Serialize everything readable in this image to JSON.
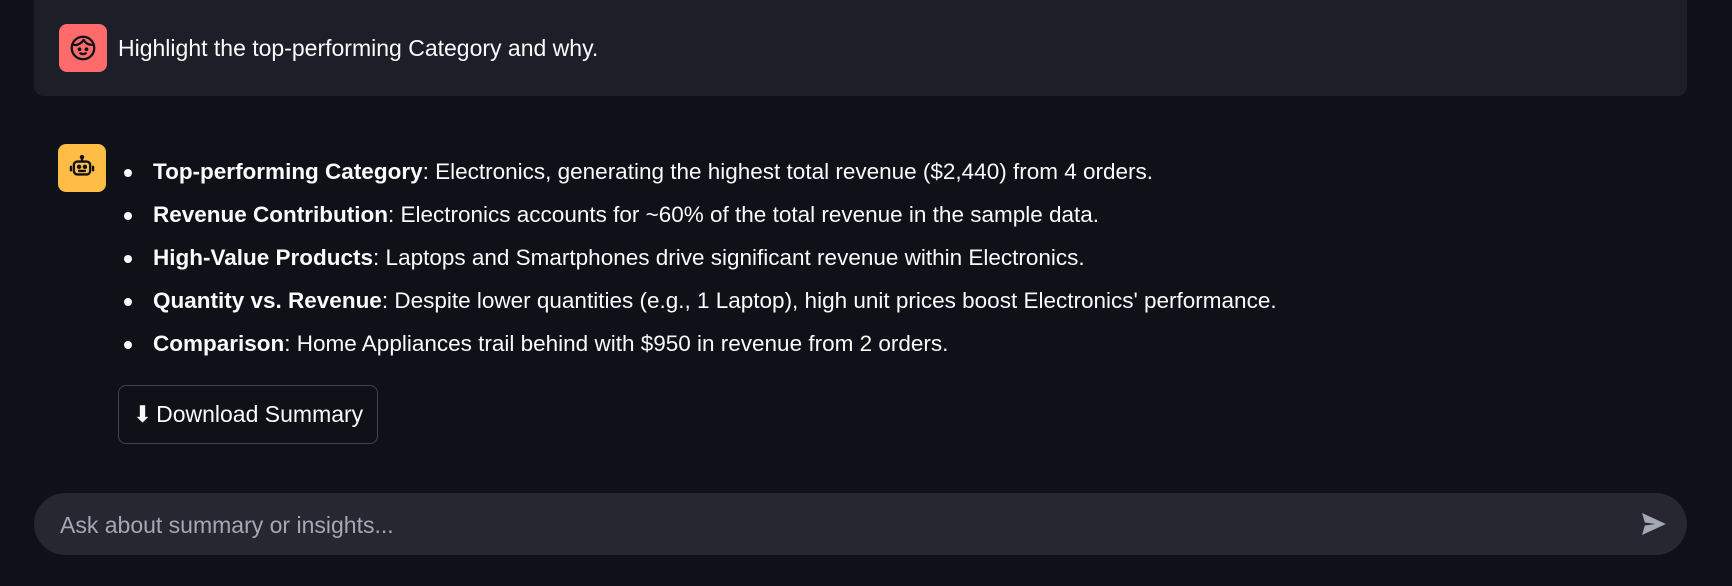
{
  "user_message": {
    "avatar_icon": "user-face-icon",
    "avatar_color": "#ff6b6b",
    "text": "Highlight the top-performing Category and why."
  },
  "assistant_message": {
    "avatar_icon": "robot-icon",
    "avatar_color": "#ffbd45",
    "bullets": [
      {
        "label": "Top-performing Category",
        "text": ": Electronics, generating the highest total revenue ($2,440) from 4 orders."
      },
      {
        "label": "Revenue Contribution",
        "text": ": Electronics accounts for ~60% of the total revenue in the sample data."
      },
      {
        "label": "High-Value Products",
        "text": ": Laptops and Smartphones drive significant revenue within Electronics."
      },
      {
        "label": "Quantity vs. Revenue",
        "text": ": Despite lower quantities (e.g., 1 Laptop), high unit prices boost Electronics' performance."
      },
      {
        "label": "Comparison",
        "text": ": Home Appliances trail behind with $950 in revenue from 2 orders."
      }
    ],
    "download_button": {
      "icon": "⬇",
      "label": "Download Summary"
    }
  },
  "chat_input": {
    "placeholder": "Ask about summary or insights...",
    "value": "",
    "send_icon": "send-icon"
  },
  "colors": {
    "background": "#0e1117",
    "user_bubble": "#1c1f28",
    "input_background": "#262730",
    "text": "#fafafa",
    "placeholder": "#a3a8b4"
  }
}
